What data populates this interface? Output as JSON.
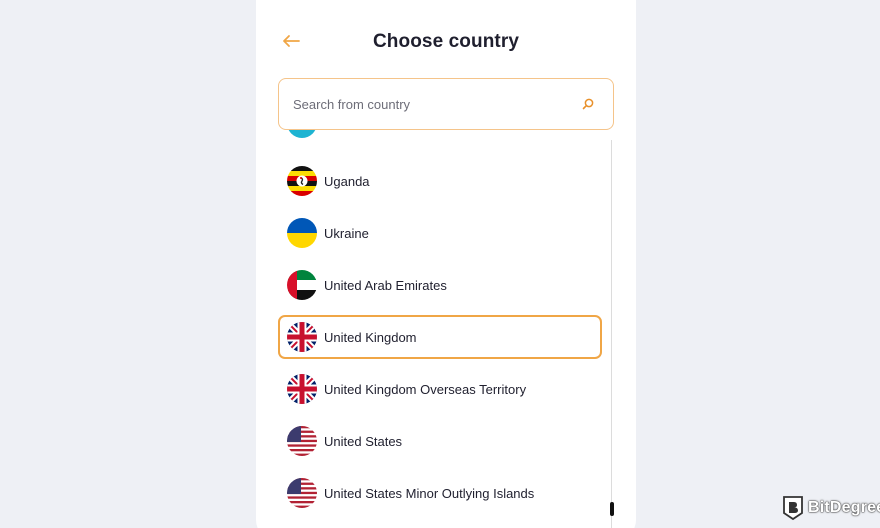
{
  "header": {
    "title": "Choose country",
    "back_icon": "arrow-left-icon"
  },
  "search": {
    "placeholder": "Search from country",
    "value": "",
    "icon": "search-icon"
  },
  "countries": [
    {
      "label": "Uganda",
      "flag": "uganda-flag-icon",
      "selected": false
    },
    {
      "label": "Ukraine",
      "flag": "ukraine-flag-icon",
      "selected": false
    },
    {
      "label": "United Arab Emirates",
      "flag": "uae-flag-icon",
      "selected": false
    },
    {
      "label": "United Kingdom",
      "flag": "uk-flag-icon",
      "selected": true
    },
    {
      "label": "United Kingdom Overseas Territory",
      "flag": "uk-flag-icon",
      "selected": false
    },
    {
      "label": "United States",
      "flag": "us-flag-icon",
      "selected": false
    },
    {
      "label": "United States Minor Outlying Islands",
      "flag": "us-flag-icon",
      "selected": false
    }
  ],
  "watermark": {
    "text": "BitDegree"
  },
  "colors": {
    "accent": "#f0a646",
    "search_border": "#f5c48a",
    "background": "#eef0f5",
    "panel": "#ffffff",
    "text": "#1f1f2e"
  }
}
